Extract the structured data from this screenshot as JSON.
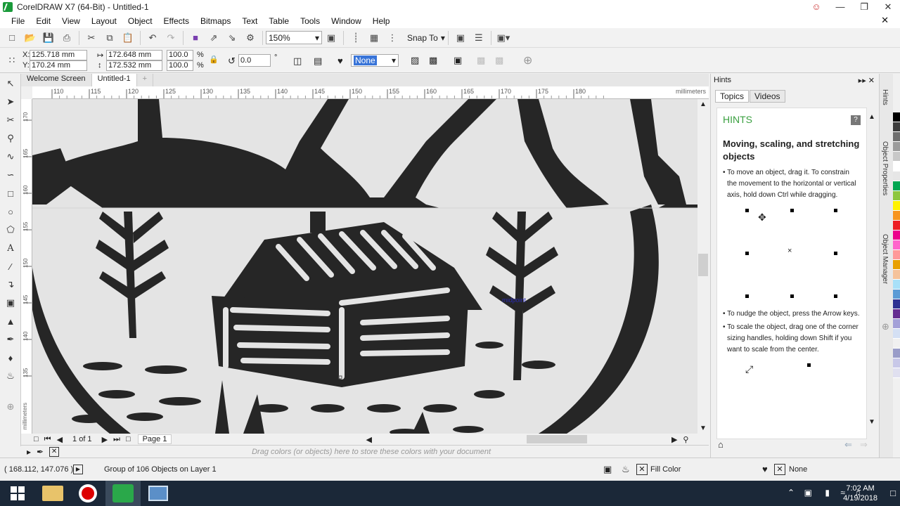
{
  "window": {
    "title": "CorelDRAW X7 (64-Bit) - Untitled-1"
  },
  "menu": [
    "File",
    "Edit",
    "View",
    "Layout",
    "Object",
    "Effects",
    "Bitmaps",
    "Text",
    "Table",
    "Tools",
    "Window",
    "Help"
  ],
  "toolbar": {
    "zoom": "150%",
    "snap_to": "Snap To"
  },
  "props": {
    "x_label": "X:",
    "x_value": "125.718 mm",
    "y_label": "Y:",
    "y_value": "170.24 mm",
    "w_value": "172.648 mm",
    "h_value": "172.532 mm",
    "sx": "100.0",
    "sy": "100.0",
    "pct": "%",
    "angle": "0.0",
    "deg": "°",
    "outline": "None"
  },
  "tabs": {
    "welcome": "Welcome Screen",
    "doc": "Untitled-1"
  },
  "ruler": {
    "h_ticks": [
      "110",
      "115",
      "120",
      "125",
      "130",
      "135",
      "140",
      "145",
      "150",
      "155",
      "160",
      "165",
      "170",
      "175",
      "180"
    ],
    "units": "millimeters",
    "v_ticks": [
      "170",
      "165",
      "160",
      "155",
      "150",
      "145",
      "140",
      "135"
    ],
    "v_units": "millimeters"
  },
  "canvas": {
    "snap_label": "midpoint"
  },
  "pagenav": {
    "count": "1 of 1",
    "page": "Page 1"
  },
  "palette_hint": "Drag colors (or objects) here to store these colors with your document",
  "status": {
    "coords": "( 168.112, 147.076 )",
    "info": "Group of 106 Objects on Layer 1",
    "fill": "Fill Color",
    "outline": "None"
  },
  "dock": {
    "title": "Hints",
    "tab_topics": "Topics",
    "tab_videos": "Videos",
    "heading": "HINTS",
    "topic": "Moving, scaling, and stretching objects",
    "p1": "• To move an object, drag it. To constrain the movement to the horizontal or vertical axis, hold down Ctrl while dragging.",
    "p2": "• To nudge the object, press the Arrow keys.",
    "p3": "• To scale the object, drag one of the corner sizing handles, holding down Shift if you want to scale from the center."
  },
  "sidetabs": {
    "hints": "Hints",
    "props": "Object Properties",
    "manager": "Object Manager"
  },
  "palette_colors": [
    "#000000",
    "#3c3c3c",
    "#6e6e6e",
    "#9b9b9b",
    "#c8c8c8",
    "#ffffff",
    "#e6e6e6",
    "#00a651",
    "#8dc63f",
    "#fff200",
    "#f7941d",
    "#ed1c24",
    "#ec008c",
    "#ff66cc",
    "#ff9999",
    "#e8a000",
    "#f5c29a",
    "#a8e0f8",
    "#5b9bd5",
    "#2e3192",
    "#662d91",
    "#a3a0d8",
    "#d4e0f4",
    "#f0f0f0",
    "#999cc8",
    "#c8c8e8",
    "#e0e0f0"
  ],
  "clock": {
    "time": "7:02 AM",
    "date": "4/19/2018"
  }
}
